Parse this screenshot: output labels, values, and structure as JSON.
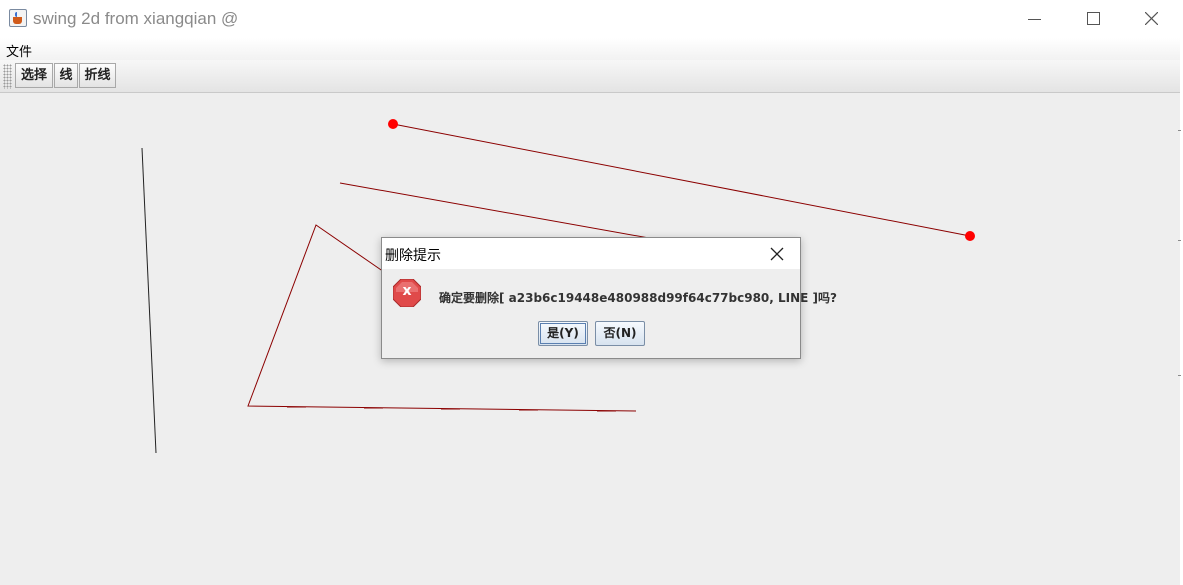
{
  "window": {
    "title": "swing 2d from xiangqian @",
    "icon": "java-coffee-icon"
  },
  "menubar": {
    "items": [
      "文件"
    ]
  },
  "toolbar": {
    "buttons": [
      {
        "label": "选择"
      },
      {
        "label": "线"
      },
      {
        "label": "折线"
      }
    ]
  },
  "canvas": {
    "line_color": "#8b0000",
    "endpoint_color": "#ff0000"
  },
  "dialog": {
    "title": "删除提示",
    "message": "确定要删除[ a23b6c19448e480988d99f64c77bc980, LINE ]吗?",
    "icon": "error-x-icon",
    "yes_label": "是(Y)",
    "no_label": "否(N)",
    "colors": {
      "error_icon": "#e04a4a"
    }
  }
}
